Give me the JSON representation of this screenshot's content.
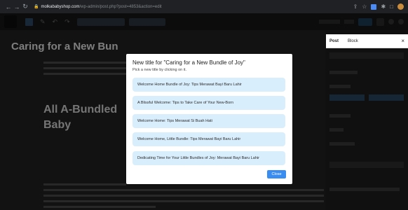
{
  "browser": {
    "url_domain": "molkababyshop.com",
    "url_path": "/wp-admin/post.php?post=4853&action=edit"
  },
  "tabs": {
    "post": "Post",
    "block": "Block",
    "close": "×"
  },
  "editor": {
    "post_title": "Caring for a New Bun",
    "heading2_line1": "All A-Bundled",
    "heading2_line2": "Baby"
  },
  "modal": {
    "title": "New title for \"Caring for a New Bundle of Joy\"",
    "subtitle": "Pick a new title by clicking on it.",
    "options": [
      "Welcome Home Bundle of Joy: Tips Merawat Bayi Baru Lahir",
      "A Blissful Welcome: Tips to Take Care of Your New-Born",
      "Welcome Home: Tips Merawat Si Buah Hati",
      "Welcome Home, Little Bundle: Tips Merawat Bayi Baru Lahir",
      "Dedicating Time for Your Little Bundles of Joy: Merawat Bayi Baru Lahir"
    ],
    "close_label": "Close"
  }
}
